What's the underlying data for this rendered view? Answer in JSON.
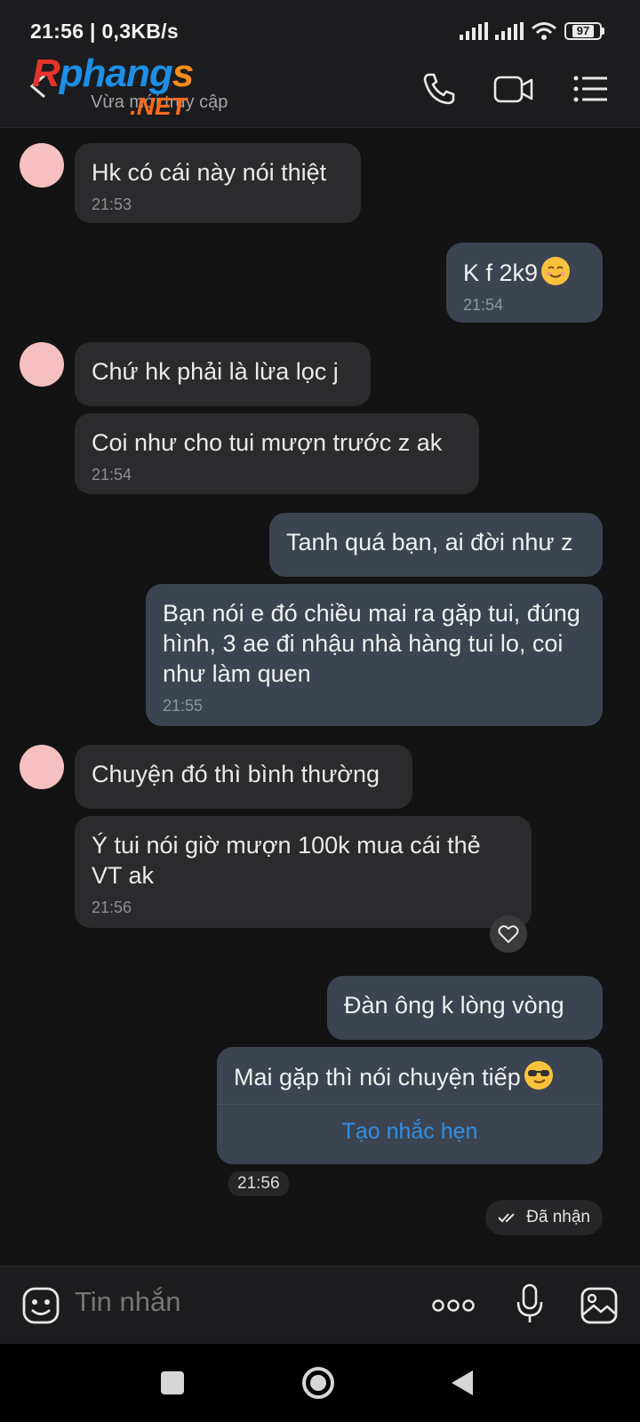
{
  "status_bar": {
    "time_speed": "21:56 | 0,3KB/s",
    "battery": "97"
  },
  "header": {
    "logo_text_a": "R",
    "logo_text_b": "phang",
    "logo_text_c": "s",
    "logo_sub": ".NET",
    "contact_status": "Vừa mới truy cập"
  },
  "messages": [
    {
      "side": "in",
      "text": "Hk có cái này nói thiệt",
      "time": "21:53"
    },
    {
      "side": "out",
      "text": "K f 2k9",
      "time": "21:54",
      "emoji": "smiling-face-emoji"
    },
    {
      "side": "in",
      "text": "Chứ hk phải là lừa lọc j",
      "time": ""
    },
    {
      "side": "in",
      "text": "Coi như cho tui mượn trước z ak",
      "time": "21:54"
    },
    {
      "side": "out",
      "text": "Tanh quá bạn, ai đời như z",
      "time": ""
    },
    {
      "side": "out",
      "text": "Bạn nói e đó chiều mai ra gặp tui, đúng hình, 3 ae đi nhậu nhà hàng tui lo, coi như làm quen",
      "time": "21:55"
    },
    {
      "side": "in",
      "text": "Chuyện đó thì bình thường",
      "time": ""
    },
    {
      "side": "in",
      "text": "Ý tui nói giờ mượn 100k mua cái thẻ VT ak",
      "time": "21:56"
    },
    {
      "side": "out",
      "text": "Đàn ông k lòng vòng",
      "time": ""
    },
    {
      "side": "out",
      "text": "Mai gặp thì nói chuyện tiếp",
      "time": "",
      "emoji": "sunglasses-emoji",
      "action": "Tạo nhắc hẹn"
    }
  ],
  "last_time": "21:56",
  "delivered": "Đã nhận",
  "input": {
    "placeholder": "Tin nhắn"
  },
  "colors": {
    "accent": "#2f8fe6",
    "incoming": "#2b2b2d",
    "outgoing": "#3b4450"
  }
}
